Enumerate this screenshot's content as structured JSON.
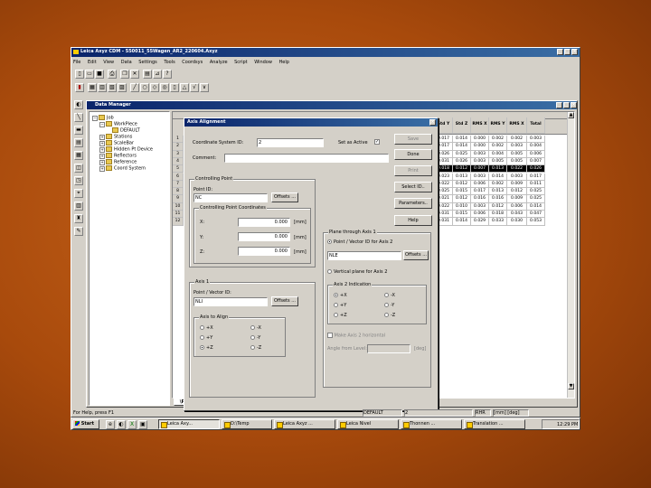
{
  "app": {
    "title": "Leica Axyz CDM - 550011_55Wagen_AR2_220604.Axyz",
    "menu": [
      "File",
      "Edit",
      "View",
      "Data",
      "Settings",
      "Tools",
      "Coordsys",
      "Analyze",
      "Script",
      "Window",
      "Help"
    ]
  },
  "data_manager": {
    "title": "Data Manager",
    "tree": [
      {
        "label": "Job",
        "level": 0
      },
      {
        "label": "WorkPiece",
        "level": 1
      },
      {
        "label": "DEFAULT",
        "level": 2
      },
      {
        "label": "Stations",
        "level": 1
      },
      {
        "label": "ScaleBar",
        "level": 1
      },
      {
        "label": "Hidden Pt Device",
        "level": 1
      },
      {
        "label": "Reflectors",
        "level": 1
      },
      {
        "label": "Reference",
        "level": 1
      },
      {
        "label": "Coord System",
        "level": 1
      }
    ],
    "row_numbers": [
      "1",
      "2",
      "3",
      "4",
      "5",
      "6",
      "7",
      "8",
      "9",
      "10",
      "11",
      "12"
    ],
    "columns": [
      "Std Y",
      "Std Z",
      "RMS X",
      "RMS Y",
      "RMS X",
      "Total RMS"
    ],
    "rows": [
      [
        "0.017",
        "0.014",
        "0.000",
        "0.002",
        "0.002",
        "0.003"
      ],
      [
        "0.017",
        "0.014",
        "0.000",
        "0.002",
        "0.003",
        "0.004"
      ],
      [
        "0.026",
        "0.025",
        "0.003",
        "0.004",
        "0.005",
        "0.006"
      ],
      [
        "0.031",
        "0.026",
        "0.003",
        "0.005",
        "0.005",
        "0.007"
      ],
      [
        "0.018",
        "0.012",
        "0.007",
        "0.013",
        "0.022",
        "0.026"
      ],
      [
        "0.023",
        "0.013",
        "0.003",
        "0.014",
        "0.003",
        "0.017"
      ],
      [
        "0.022",
        "0.012",
        "0.006",
        "0.002",
        "0.009",
        "0.011"
      ],
      [
        "0.025",
        "0.015",
        "0.017",
        "0.013",
        "0.012",
        "0.025"
      ],
      [
        "0.021",
        "0.012",
        "0.016",
        "0.016",
        "0.009",
        "0.025"
      ],
      [
        "0.022",
        "0.010",
        "0.003",
        "0.012",
        "0.006",
        "0.014"
      ],
      [
        "0.031",
        "0.015",
        "0.006",
        "0.018",
        "0.043",
        "0.047"
      ],
      [
        "0.031",
        "0.014",
        "0.029",
        "0.033",
        "0.030",
        "0.053"
      ]
    ],
    "selected_row": 4,
    "tabs": [
      "\\Points",
      "Measurements",
      "Shapes",
      "ControlPt",
      "LT Meas",
      "Sett"
    ]
  },
  "dialog": {
    "title": "Axis Alignment",
    "coord_system_label": "Coordinate System ID:",
    "coord_system_value": "2",
    "set_as_active_label": "Set as Active",
    "set_as_active_checked": "✓",
    "comment_label": "Comment:",
    "comment_value": "",
    "controlling_point": {
      "title": "Controlling Point",
      "point_id_label": "Point ID:",
      "point_id_value": "NC",
      "offsets": "Offsets ...",
      "coords_title": "Controlling Point Coordinates",
      "x_label": "X:",
      "x_value": "0.000",
      "y_label": "Y:",
      "y_value": "0.000",
      "z_label": "Z:",
      "z_value": "0.000",
      "unit": "[mm]"
    },
    "axis1": {
      "title": "Axis 1",
      "point_label": "Point / Vector ID:",
      "point_value": "NLI",
      "offsets": "Offsets ...",
      "align_title": "Axis to Align",
      "options": [
        "+X",
        "-X",
        "+Y",
        "-Y",
        "+Z",
        "-Z"
      ],
      "selected": "+Z"
    },
    "plane": {
      "title": "Plane through Axis 1",
      "opt1": "Point / Vector ID for Axis 2",
      "value": "NLE",
      "offsets": "Offsets ...",
      "opt2": "Vertical plane for Axis 2",
      "axis2_title": "Axis 2 Indication",
      "axis2_options": [
        "+X",
        "-X",
        "+Y",
        "-Y",
        "+Z",
        "-Z"
      ],
      "axis2_selected": "+X",
      "make_horizontal": "Make Axis 2 horizontal",
      "angle_label": "Angle from Level:",
      "angle_unit": "[deg]"
    },
    "buttons": [
      "Save",
      "Done",
      "Print",
      "Select ID..",
      "Parameters..",
      "Help"
    ]
  },
  "status": {
    "help": "For Help, press F1",
    "default": "DEFAULT",
    "num": "2",
    "mode": "RHR",
    "units": "[mm] [deg]"
  },
  "taskbar": {
    "start": "Start",
    "items": [
      "Leica Axy...",
      "D:\\Temp",
      "Leica Axyz ...",
      "Leica Nivel",
      "Thonnen ...",
      "Translation ..."
    ],
    "clock": "12:29 PM"
  }
}
